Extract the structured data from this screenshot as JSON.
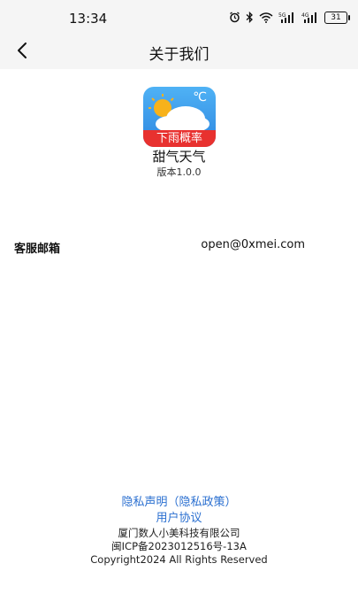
{
  "status_bar": {
    "time": "13:34",
    "battery": "31",
    "icons": [
      "alarm-icon",
      "bluetooth-icon",
      "wifi-icon",
      "signal-5g-icon",
      "signal-4g-icon",
      "battery-icon"
    ]
  },
  "nav": {
    "title": "关于我们",
    "back_icon": "chevron-left-icon"
  },
  "app": {
    "icon_badge": "下雨概率",
    "icon_symbol": "℃",
    "name": "甜气天气",
    "version": "版本1.0.0"
  },
  "contact": {
    "label": "客服邮箱",
    "email": "open@0xmei.com"
  },
  "footer": {
    "privacy_link": "隐私声明（隐私政策）",
    "user_agreement_link": "用户协议",
    "company": "厦门数人小美科技有限公司",
    "icp": "闽ICP备2023012516号-13A",
    "copyright": "Copyright2024 All Rights Reserved"
  },
  "colors": {
    "link": "#2a6fd0",
    "bar_background": "#f5f5f5",
    "badge_red": "#e8312f",
    "icon_blue": "#3a9cee"
  }
}
